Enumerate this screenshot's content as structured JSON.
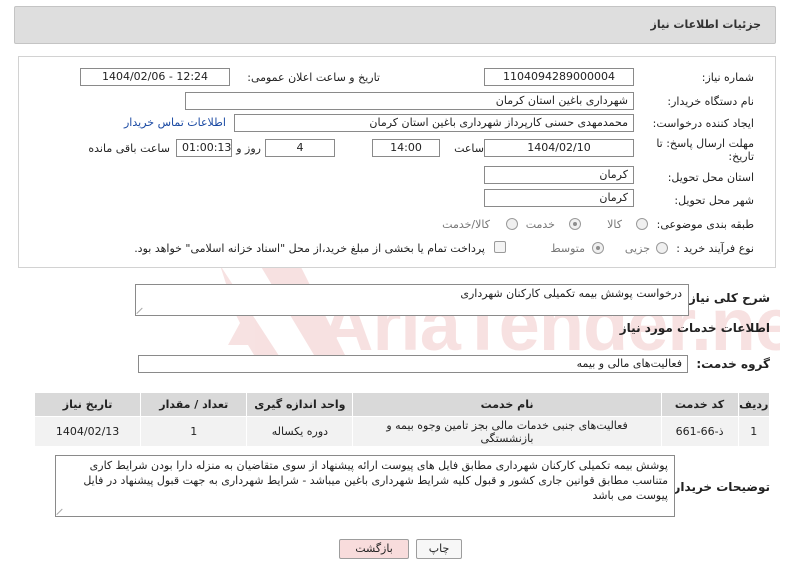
{
  "header": {
    "title": "جزئیات اطلاعات نیاز"
  },
  "form": {
    "need_number_label": "شماره نیاز:",
    "need_number": "1104094289000004",
    "announce_label": "تاریخ و ساعت اعلان عمومی:",
    "announce_value": "1404/02/06 - 12:24",
    "buyer_org_label": "نام دستگاه خریدار:",
    "buyer_org": "شهرداری باغین استان کرمان",
    "creator_label": "ایجاد کننده درخواست:",
    "creator": "محمدمهدی حسنی کارپرداز شهرداری باغین استان کرمان",
    "contact_link": "اطلاعات تماس خریدار",
    "deadline_label": "مهلت ارسال پاسخ: تا تاریخ:",
    "deadline_date": "1404/02/10",
    "time_label": "ساعت",
    "deadline_time": "14:00",
    "days_value": "4",
    "days_label": "روز و",
    "remaining_time": "01:00:13",
    "remaining_label": "ساعت باقی مانده",
    "province_label": "استان محل تحویل:",
    "province": "کرمان",
    "city_label": "شهر محل تحویل:",
    "city": "کرمان",
    "category_label": "طبقه بندی موضوعی:",
    "category_options": [
      "کالا",
      "خدمت",
      "کالا/خدمت"
    ],
    "process_label": "نوع فرآیند خرید :",
    "process_options": [
      "جزیی",
      "متوسط"
    ],
    "payment_note": "پرداخت تمام یا بخشی از مبلغ خرید،از محل \"اسناد خزانه اسلامی\" خواهد بود."
  },
  "summary": {
    "label": "شرح کلی نیاز:",
    "text": "درخواست پوشش بیمه تکمیلی کارکنان شهرداری"
  },
  "services": {
    "section_title": "اطلاعات خدمات مورد نیاز",
    "group_label": "گروه خدمت:",
    "group_value": "فعالیت‌های مالی و بیمه",
    "columns": [
      "ردیف",
      "کد خدمت",
      "نام خدمت",
      "واحد اندازه گیری",
      "تعداد / مقدار",
      "تاریخ نیاز"
    ],
    "rows": [
      {
        "row": "1",
        "code": "ذ-66-661",
        "name": "فعالیت‌های جنبی خدمات مالی بجز تامین وجوه بیمه و بازنشستگی",
        "unit": "دوره یکساله",
        "qty": "1",
        "date": "1404/02/13"
      }
    ]
  },
  "buyer_notes": {
    "label": "توضیحات خریدار:",
    "text": "پوشش بیمه تکمیلی کارکنان شهرداری مطابق فایل های پیوست ارائه پیشنهاد از سوی متقاضیان به منزله دارا بودن شرایط کاری متناسب مطابق قوانین جاری کشور و قبول کلیه شرایط شهرداری باغین میباشد - شرایط شهرداری به جهت قبول پیشنهاد در فایل پیوست می باشد"
  },
  "buttons": {
    "print": "چاپ",
    "back": "بازگشت"
  },
  "watermark": {
    "text": "AriaTender.neT"
  },
  "colors": {
    "header_bg": "#dedede",
    "link": "#1b4aa3",
    "back_button": "#f8dcdc",
    "watermark": "#f1caca"
  }
}
